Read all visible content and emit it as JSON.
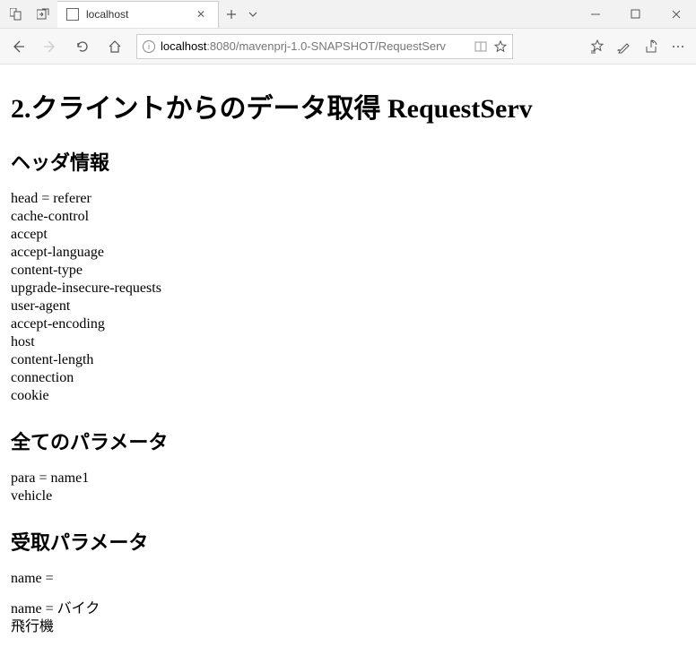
{
  "tab": {
    "title": "localhost"
  },
  "address": {
    "host": "localhost",
    "rest": ":8080/mavenprj-1.0-SNAPSHOT/RequestServ"
  },
  "page": {
    "title": "2.クライントからのデータ取得 RequestServ",
    "section_headers": "ヘッダ情報",
    "headers_lines": [
      "head = referer",
      "cache-control",
      "accept",
      "accept-language",
      "content-type",
      "upgrade-insecure-requests",
      "user-agent",
      "accept-encoding",
      "host",
      "content-length",
      "connection",
      "cookie"
    ],
    "section_params": "全てのパラメータ",
    "params_lines": [
      "para = name1",
      "vehicle"
    ],
    "section_recv": "受取パラメータ",
    "recv_first": "name =",
    "recv_lines": [
      "name = バイク",
      "飛行機"
    ]
  }
}
